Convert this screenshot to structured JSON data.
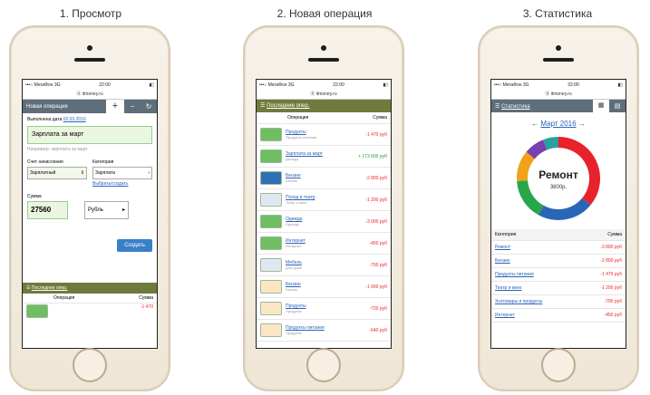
{
  "captions": [
    "1. Просмотр",
    "2. Новая операция",
    "3. Статистика"
  ],
  "status": {
    "carrier": "•••○ МегаФон 3G",
    "time": "22:00",
    "url": "Ⓐ itmoney.ru"
  },
  "phone1": {
    "tab_label": "Новая операция",
    "date_label": "Выполнена дата",
    "date_value": "02.03.2016",
    "title_input": "Зарплата за март",
    "hint_text": "Например: зарплата за март",
    "account_label": "Счет начисления",
    "account_value": "Зарплатный",
    "category_label": "Категория",
    "category_value": "Зарплата",
    "category_link": "Выбрать/создать",
    "sum_label": "Сумма",
    "sum_value": "27560",
    "currency": "Рубль",
    "submit": "Создать",
    "recent_title": "Последние опер.",
    "col_op": "Операция",
    "col_sum": "Сумма",
    "peek_value": "-1 470"
  },
  "phone2": {
    "header": "Последние опер.",
    "col_op": "Операция",
    "col_sum": "Сумма",
    "rows": [
      {
        "name": "Продукты",
        "sub": "Продукты питания",
        "amount": "-1 470 руб",
        "type": "neg",
        "icon": "green"
      },
      {
        "name": "Зарплата за март",
        "sub": "Доходы",
        "amount": "+ 173 600 руб",
        "type": "pos",
        "icon": "green"
      },
      {
        "name": "Бензин",
        "sub": "Бензин",
        "amount": "-2 800 руб",
        "type": "neg",
        "icon": "card"
      },
      {
        "name": "Поход в театр",
        "sub": "Театр и кино",
        "amount": "-1 200 руб",
        "type": "neg",
        "icon": "card2"
      },
      {
        "name": "Одежда",
        "sub": "Одежда",
        "amount": "-3 000 руб",
        "type": "neg",
        "icon": "green"
      },
      {
        "name": "Интернет",
        "sub": "Интернет",
        "amount": "-450 руб",
        "type": "neg",
        "icon": "green"
      },
      {
        "name": "Мебель",
        "sub": "Для дома",
        "amount": "-700 руб",
        "type": "neg",
        "icon": "card2"
      },
      {
        "name": "Бензин",
        "sub": "Бензин",
        "amount": "-1 000 руб",
        "type": "neg",
        "icon": "cream"
      },
      {
        "name": "Продукты",
        "sub": "Продукты",
        "amount": "-720 руб",
        "type": "neg",
        "icon": "cream"
      },
      {
        "name": "Продукты питания",
        "sub": "Продукты",
        "amount": "-640 руб",
        "type": "neg",
        "icon": "cream"
      }
    ]
  },
  "phone3": {
    "header": "Статистика",
    "month": "Март 2016",
    "donut_title": "Ремонт",
    "donut_value": "3800р.",
    "col_cat": "Категория",
    "col_sum": "Сумма",
    "rows": [
      {
        "name": "Ремонт",
        "amount": "-3 800 руб"
      },
      {
        "name": "Бензин",
        "amount": "-2 800 руб"
      },
      {
        "name": "Продукты питания",
        "amount": "-1 470 руб"
      },
      {
        "name": "Театр и кино",
        "amount": "-1 200 руб"
      },
      {
        "name": "Хозтовары и продукты",
        "amount": "-790 руб"
      },
      {
        "name": "Интернет",
        "amount": "-450 руб"
      }
    ],
    "donut_colors": [
      "#e8222a",
      "#2a66b8",
      "#2aa64a",
      "#f1a21a",
      "#7a3fb0",
      "#2aa0a0"
    ]
  }
}
